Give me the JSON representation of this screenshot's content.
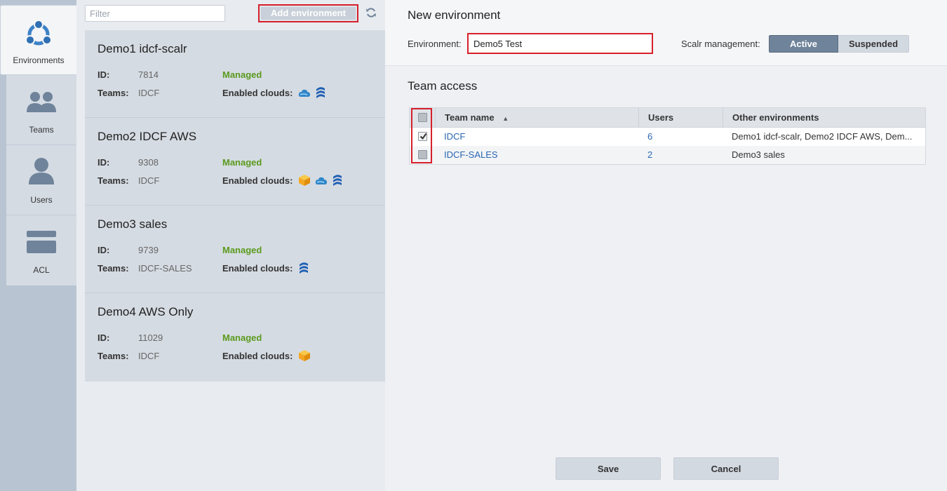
{
  "nav": {
    "items": [
      {
        "label": "Environments",
        "icon": "environments-icon",
        "active": true
      },
      {
        "label": "Teams",
        "icon": "teams-icon"
      },
      {
        "label": "Users",
        "icon": "user-icon"
      },
      {
        "label": "ACL",
        "icon": "acl-icon"
      }
    ]
  },
  "list": {
    "filter_placeholder": "Filter",
    "add_button_label": "Add environment",
    "refresh_icon": "refresh-icon",
    "id_label": "ID:",
    "teams_label": "Teams:",
    "clouds_label": "Enabled clouds:",
    "environments": [
      {
        "name": "Demo1 idcf-scalr",
        "id": "7814",
        "status": "Managed",
        "teams": "IDCF",
        "clouds": [
          "cloudstack-icon",
          "idcf-icon"
        ]
      },
      {
        "name": "Demo2 IDCF AWS",
        "id": "9308",
        "status": "Managed",
        "teams": "IDCF",
        "clouds": [
          "aws-icon",
          "cloudstack-icon",
          "idcf-icon"
        ]
      },
      {
        "name": "Demo3 sales",
        "id": "9739",
        "status": "Managed",
        "teams": "IDCF-SALES",
        "clouds": [
          "idcf-icon"
        ]
      },
      {
        "name": "Demo4 AWS Only",
        "id": "11029",
        "status": "Managed",
        "teams": "IDCF",
        "clouds": [
          "aws-icon"
        ]
      }
    ]
  },
  "form": {
    "title": "New environment",
    "environment_label": "Environment:",
    "environment_value": "Demo5 Test",
    "scalr_label": "Scalr management:",
    "management_options": [
      "Active",
      "Suspended"
    ],
    "management_selected": "Active",
    "team_access_title": "Team access",
    "columns": [
      "Team name",
      "Users",
      "Other environments"
    ],
    "sort_indicator": "▲",
    "rows": [
      {
        "checked": true,
        "team": "IDCF",
        "users": "6",
        "other": "Demo1 idcf-scalr, Demo2 IDCF AWS, Dem..."
      },
      {
        "checked": false,
        "team": "IDCF-SALES",
        "users": "2",
        "other": "Demo3 sales"
      }
    ],
    "save_label": "Save",
    "cancel_label": "Cancel"
  },
  "colors": {
    "highlight": "#d6202b",
    "managed": "#5a9a1e",
    "link": "#2a67b1",
    "active_segment": "#6f839a"
  }
}
